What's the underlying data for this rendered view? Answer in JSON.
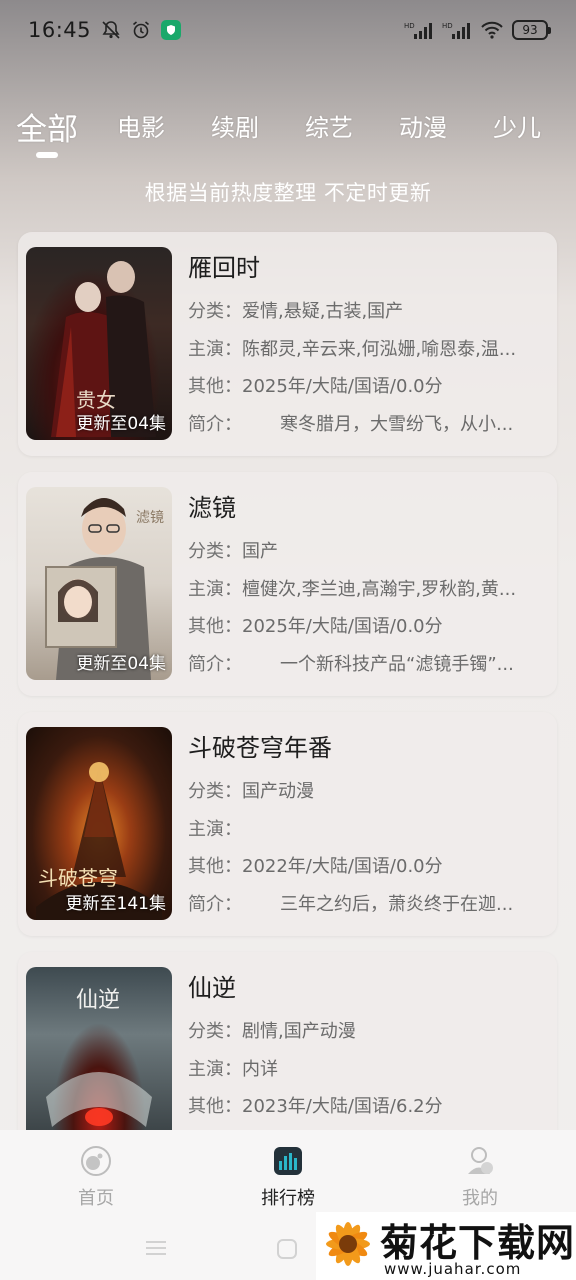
{
  "status_bar": {
    "time": "16:45",
    "battery": "93",
    "net_label_1": "HD",
    "net_label_2": "HD"
  },
  "tabs": [
    {
      "label": "全部",
      "active": true
    },
    {
      "label": "电影"
    },
    {
      "label": "续剧"
    },
    {
      "label": "综艺"
    },
    {
      "label": "动漫"
    },
    {
      "label": "少儿"
    }
  ],
  "subtitle": "根据当前热度整理 不定时更新",
  "field_labels": {
    "category": "分类：",
    "cast": "主演：",
    "other": "其他：",
    "intro": "简介："
  },
  "items": [
    {
      "title": "雁回时",
      "category": "爱情,悬疑,古装,国产",
      "cast": "陈都灵,辛云来,何泓姗,喻恩泰,温...",
      "other": "2025年/大陆/国语/0.0分",
      "intro": "寒冬腊月，大雪纷飞，从小...",
      "badge": "更新至04集",
      "poster_text": "贵女"
    },
    {
      "title": "滤镜",
      "category": "国产",
      "cast": "檀健次,李兰迪,高瀚宇,罗秋韵,黄...",
      "other": "2025年/大陆/国语/0.0分",
      "intro": "一个新科技产品“滤镜手镯”...",
      "badge": "更新至04集",
      "poster_text": "滤镜"
    },
    {
      "title": "斗破苍穹年番",
      "category": "国产动漫",
      "cast": "",
      "other": "2022年/大陆/国语/0.0分",
      "intro": "三年之约后，萧炎终于在迦...",
      "badge": "更新至141集",
      "poster_text": "斗破苍穹"
    },
    {
      "title": "仙逆",
      "category": "剧情,国产动漫",
      "cast": "内详",
      "other": "2023年/大陆/国语/6.2分",
      "intro": "",
      "badge": "",
      "poster_text": "仙逆"
    }
  ],
  "bottom_nav": [
    {
      "label": "首页",
      "icon": "home-icon"
    },
    {
      "label": "排行榜",
      "icon": "ranking-icon",
      "active": true
    },
    {
      "label": "我的",
      "icon": "profile-icon"
    }
  ],
  "watermark": {
    "title": "菊花下载网",
    "url": "www.juahar.com"
  },
  "colors": {
    "tab_text": "#ffffff",
    "card_bg": "#f0ecea",
    "accent_ranking": "#2bb6c9",
    "watermark_flower": "#f29a1b"
  }
}
